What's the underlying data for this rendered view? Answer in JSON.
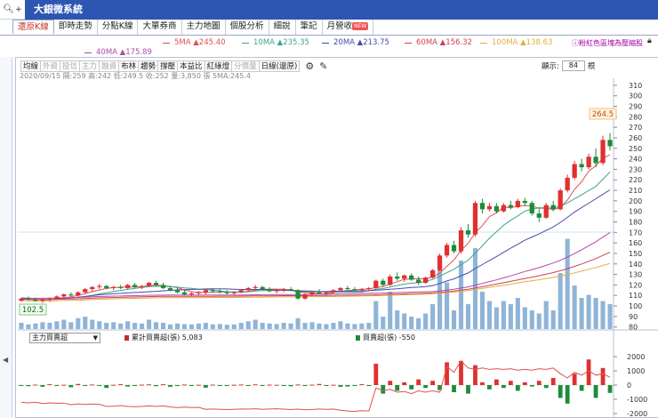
{
  "app": {
    "title": "大銀微系統"
  },
  "tabs": [
    {
      "label": "還原K線",
      "active": true
    },
    {
      "label": "即時走勢"
    },
    {
      "label": "分點K線"
    },
    {
      "label": "大單券商"
    },
    {
      "label": "主力地圖"
    },
    {
      "label": "個股分析"
    },
    {
      "label": "細說"
    },
    {
      "label": "筆記"
    },
    {
      "label": "月營收",
      "badge": "NEW"
    }
  ],
  "ma_legend": [
    {
      "label": "5MA ▲245.40",
      "color": "#e05050"
    },
    {
      "label": "10MA ▲235.35",
      "color": "#3aa68e"
    },
    {
      "label": "20MA ▲213.75",
      "color": "#4a4aa8"
    },
    {
      "label": "60MA ▲156.32",
      "color": "#d04050"
    },
    {
      "label": "100MA ▲138.63",
      "color": "#e0b040"
    },
    {
      "label": "40MA ▲175.89",
      "color": "#b04aa8"
    }
  ],
  "promo_text": "粉紅色區塊為壓縮股",
  "toolbar": [
    {
      "label": "均線"
    },
    {
      "label": "外資",
      "disabled": true
    },
    {
      "label": "投信",
      "disabled": true
    },
    {
      "label": "主力",
      "disabled": true
    },
    {
      "label": "融資",
      "disabled": true
    },
    {
      "label": "布林"
    },
    {
      "label": "趨勢"
    },
    {
      "label": "撐壓"
    },
    {
      "label": "本益比"
    },
    {
      "label": "紅綠燈"
    },
    {
      "label": "分價量",
      "disabled": true
    },
    {
      "label": "日線(還原)"
    }
  ],
  "date_readout": "2020/09/15 開:259 高:242 低:249.5 收:252 量:3,850 張 5MA:245.4",
  "display": {
    "label": "顯示:",
    "value": "84",
    "unit": "根"
  },
  "price": {
    "current": "264.5",
    "low_marker": "102.5"
  },
  "indicator": {
    "selected": "主力買賣超",
    "legend": [
      {
        "label": "累計買賣超(張) 5,083",
        "color": "#c03030"
      },
      {
        "label": "買賣超(張) -550",
        "color": "#c03030"
      }
    ]
  },
  "colors": {
    "up": "#e03030",
    "down": "#1e8c3a",
    "volume": "#8fb4d8",
    "accent": "#2d56b3"
  },
  "chart_data": {
    "type": "candlestick",
    "n_bars": 84,
    "price_axis": {
      "ticks": [
        80,
        90,
        100,
        110,
        120,
        130,
        140,
        150,
        160,
        170,
        180,
        190,
        200,
        210,
        220,
        230,
        240,
        250,
        260,
        270,
        280,
        290,
        300,
        310
      ]
    },
    "indicator_axis": {
      "ticks": [
        2000,
        1000,
        0,
        -1000,
        -2000
      ]
    },
    "ohlc": [
      [
        105,
        108,
        104,
        107
      ],
      [
        107,
        109,
        105,
        106
      ],
      [
        106,
        108,
        104,
        105
      ],
      [
        105,
        107,
        103,
        106
      ],
      [
        106,
        108,
        104,
        107
      ],
      [
        107,
        110,
        106,
        109
      ],
      [
        109,
        112,
        108,
        111
      ],
      [
        111,
        113,
        109,
        110
      ],
      [
        110,
        114,
        109,
        113
      ],
      [
        113,
        117,
        112,
        116
      ],
      [
        116,
        119,
        114,
        118
      ],
      [
        118,
        121,
        116,
        119
      ],
      [
        119,
        120,
        116,
        117
      ],
      [
        117,
        119,
        115,
        118
      ],
      [
        118,
        120,
        116,
        117
      ],
      [
        117,
        121,
        116,
        120
      ],
      [
        120,
        122,
        117,
        118
      ],
      [
        118,
        120,
        116,
        119
      ],
      [
        119,
        123,
        118,
        122
      ],
      [
        122,
        124,
        119,
        120
      ],
      [
        120,
        122,
        116,
        117
      ],
      [
        117,
        119,
        114,
        115
      ],
      [
        115,
        117,
        112,
        113
      ],
      [
        113,
        115,
        110,
        111
      ],
      [
        111,
        113,
        109,
        112
      ],
      [
        112,
        114,
        110,
        113
      ],
      [
        113,
        116,
        111,
        115
      ],
      [
        115,
        117,
        113,
        114
      ],
      [
        114,
        116,
        112,
        113
      ],
      [
        113,
        115,
        111,
        112
      ],
      [
        112,
        114,
        110,
        113
      ],
      [
        113,
        116,
        112,
        115
      ],
      [
        115,
        118,
        114,
        117
      ],
      [
        117,
        120,
        115,
        118
      ],
      [
        118,
        119,
        115,
        116
      ],
      [
        116,
        118,
        113,
        114
      ],
      [
        114,
        116,
        112,
        115
      ],
      [
        115,
        117,
        113,
        116
      ],
      [
        116,
        118,
        114,
        115
      ],
      [
        115,
        116,
        106,
        107
      ],
      [
        107,
        112,
        106,
        111
      ],
      [
        111,
        114,
        110,
        113
      ],
      [
        113,
        116,
        111,
        112
      ],
      [
        112,
        114,
        110,
        113
      ],
      [
        113,
        116,
        112,
        115
      ],
      [
        115,
        118,
        114,
        117
      ],
      [
        117,
        119,
        115,
        116
      ],
      [
        116,
        118,
        114,
        115
      ],
      [
        115,
        117,
        113,
        116
      ],
      [
        116,
        118,
        114,
        117
      ],
      [
        117,
        125,
        116,
        124
      ],
      [
        124,
        126,
        118,
        120
      ],
      [
        120,
        130,
        119,
        128
      ],
      [
        128,
        132,
        124,
        126
      ],
      [
        126,
        130,
        123,
        129
      ],
      [
        129,
        131,
        124,
        125
      ],
      [
        125,
        128,
        120,
        122
      ],
      [
        122,
        128,
        121,
        127
      ],
      [
        127,
        135,
        126,
        134
      ],
      [
        134,
        150,
        133,
        148
      ],
      [
        148,
        160,
        146,
        158
      ],
      [
        158,
        162,
        150,
        152
      ],
      [
        152,
        175,
        150,
        172
      ],
      [
        172,
        178,
        165,
        168
      ],
      [
        168,
        200,
        166,
        198
      ],
      [
        198,
        202,
        188,
        192
      ],
      [
        192,
        198,
        190,
        195
      ],
      [
        195,
        198,
        188,
        190
      ],
      [
        190,
        198,
        189,
        196
      ],
      [
        196,
        200,
        192,
        194
      ],
      [
        194,
        202,
        193,
        200
      ],
      [
        200,
        203,
        195,
        198
      ],
      [
        198,
        200,
        186,
        188
      ],
      [
        188,
        192,
        180,
        184
      ],
      [
        184,
        198,
        183,
        196
      ],
      [
        196,
        200,
        190,
        192
      ],
      [
        192,
        212,
        191,
        210
      ],
      [
        210,
        225,
        208,
        222
      ],
      [
        222,
        238,
        220,
        235
      ],
      [
        235,
        240,
        228,
        232
      ],
      [
        232,
        245,
        230,
        242
      ],
      [
        242,
        250,
        232,
        236
      ],
      [
        236,
        262,
        234,
        258
      ],
      [
        258,
        264.5,
        248,
        252
      ]
    ],
    "volume_rel": [
      0.2,
      0.15,
      0.18,
      0.22,
      0.2,
      0.25,
      0.3,
      0.22,
      0.35,
      0.4,
      0.3,
      0.25,
      0.2,
      0.22,
      0.18,
      0.25,
      0.2,
      0.18,
      0.3,
      0.22,
      0.2,
      0.15,
      0.18,
      0.16,
      0.15,
      0.18,
      0.2,
      0.15,
      0.16,
      0.14,
      0.15,
      0.2,
      0.25,
      0.3,
      0.2,
      0.18,
      0.16,
      0.2,
      0.18,
      0.35,
      0.2,
      0.22,
      0.18,
      0.16,
      0.2,
      0.25,
      0.18,
      0.16,
      0.18,
      0.2,
      0.9,
      0.4,
      1.2,
      0.6,
      0.5,
      0.4,
      0.35,
      0.5,
      0.8,
      1.9,
      1.5,
      0.6,
      2.2,
      0.8,
      2.6,
      1.2,
      0.9,
      0.7,
      0.9,
      0.8,
      1.0,
      0.7,
      0.6,
      0.5,
      0.9,
      0.6,
      1.8,
      2.9,
      1.4,
      1.0,
      1.1,
      1.0,
      0.9,
      0.8
    ],
    "flow": [
      -50,
      -80,
      30,
      -120,
      60,
      -40,
      20,
      -150,
      80,
      -60,
      40,
      -30,
      -200,
      20,
      60,
      -100,
      -40,
      30,
      50,
      -80,
      60,
      -120,
      -60,
      40,
      -50,
      20,
      -180,
      30,
      -40,
      -60,
      20,
      40,
      -30,
      50,
      -60,
      30,
      20,
      -40,
      -80,
      40,
      -60,
      30,
      80,
      -50,
      20,
      -120,
      -100,
      -60,
      60,
      -40,
      1500,
      -600,
      300,
      -400,
      200,
      -300,
      400,
      -200,
      300,
      -350,
      1600,
      -500,
      1700,
      -600,
      1400,
      200,
      -300,
      400,
      -200,
      300,
      -400,
      200,
      -100,
      300,
      -200,
      500,
      -900,
      -1300,
      800,
      -400,
      1800,
      -900,
      1200,
      -550
    ],
    "cum_flow": [
      -1200,
      -1250,
      -1200,
      -1300,
      -1250,
      -1280,
      -1260,
      -1380,
      -1320,
      -1360,
      -1330,
      -1350,
      -1500,
      -1480,
      -1440,
      -1500,
      -1520,
      -1500,
      -1460,
      -1500,
      -1460,
      -1540,
      -1580,
      -1550,
      -1580,
      -1560,
      -1700,
      -1680,
      -1700,
      -1720,
      -1700,
      -1680,
      -1690,
      -1660,
      -1700,
      -1680,
      -1660,
      -1690,
      -1720,
      -1690,
      -1740,
      -1720,
      -1680,
      -1700,
      -1690,
      -1760,
      -1820,
      -1850,
      -1800,
      -1820,
      -200,
      -400,
      -300,
      -500,
      -450,
      -600,
      -400,
      -500,
      -400,
      -500,
      1300,
      900,
      1700,
      1200,
      1100,
      1200,
      1100,
      1150,
      1100,
      1150,
      1050,
      1100,
      1050,
      1150,
      1100,
      1200,
      800,
      500,
      900,
      700,
      1000,
      700,
      800,
      550
    ]
  }
}
